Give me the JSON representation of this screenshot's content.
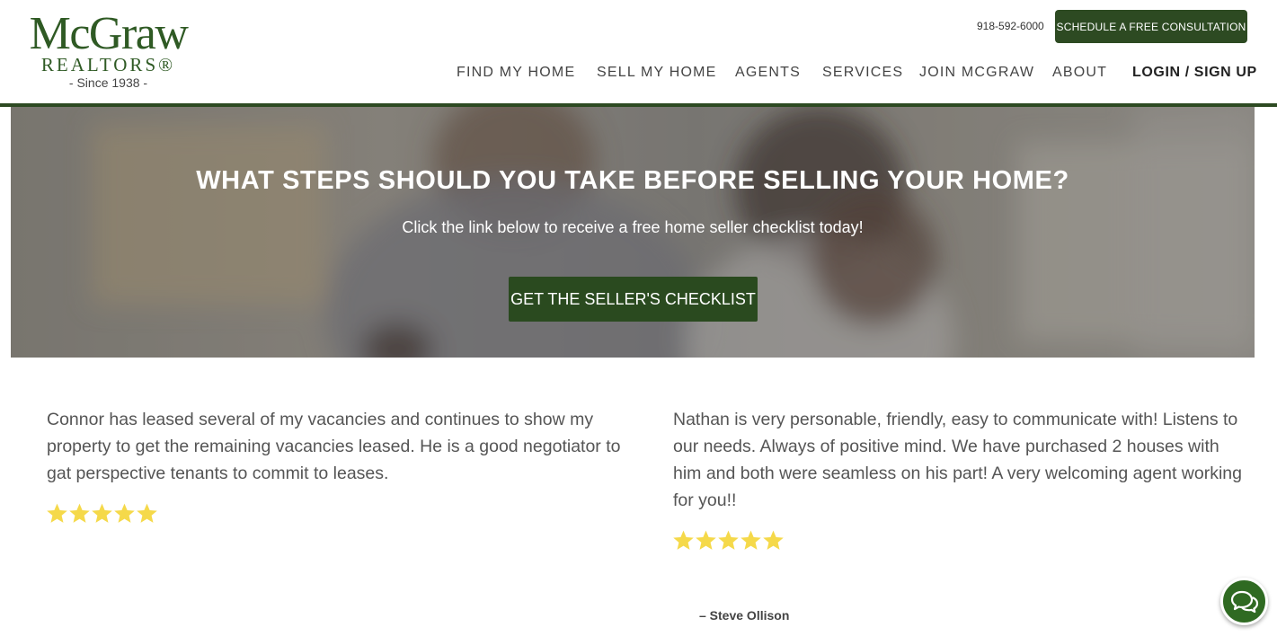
{
  "brand": {
    "name": "McGraw",
    "sub": "REALTORS®",
    "since": "- Since 1938 -",
    "color": "#2d4a22"
  },
  "header": {
    "phone": "918-592-6000",
    "consult_label": "SCHEDULE A FREE CONSULTATION"
  },
  "nav": {
    "items": [
      {
        "label": "FIND MY HOME"
      },
      {
        "label": "SELL MY HOME"
      },
      {
        "label": "AGENTS"
      },
      {
        "label": "SERVICES"
      },
      {
        "label": "JOIN MCGRAW"
      },
      {
        "label": "ABOUT"
      },
      {
        "label": "LOGIN / SIGN UP"
      }
    ]
  },
  "hero": {
    "title": "WHAT STEPS SHOULD YOU TAKE BEFORE SELLING YOUR HOME?",
    "subtitle": "Click the link below to receive a free home seller checklist today!",
    "button_label": "GET THE SELLER'S CHECKLIST"
  },
  "testimonials": [
    {
      "text": "Connor has leased several of my vacancies and continues to show my property to get the remaining vacancies leased. He is a good negotiator to gat perspective tenants to commit to leases.",
      "rating": 5
    },
    {
      "text": "Nathan is very personable, friendly, easy to communicate with! Listens to our needs. Always of positive mind. We have purchased 2 houses with him and both were seamless on his part! A very welcoming agent working for you!!",
      "rating": 5,
      "author": "– Steve Ollison"
    }
  ],
  "colors": {
    "star": "#f5d94a",
    "chat": "#2f6a22"
  },
  "icons": {
    "chat": "chat-bubbles-icon",
    "star": "star-icon"
  }
}
